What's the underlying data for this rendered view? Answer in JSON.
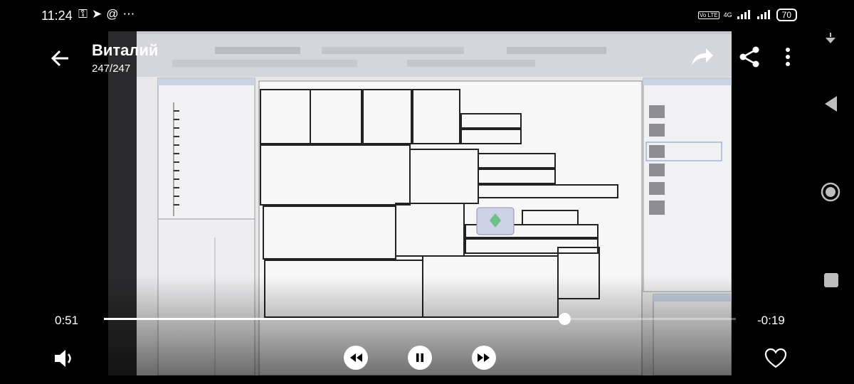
{
  "status_bar": {
    "time": "11:24",
    "left_icons": [
      "key-icon",
      "telegram-icon",
      "at-icon",
      "more-dots-icon"
    ],
    "network": "4G",
    "volte": "Vo LTE",
    "battery": "70"
  },
  "header": {
    "title": "Виталий",
    "subtitle": "247/247"
  },
  "player": {
    "elapsed": "0:51",
    "remaining": "-0:19",
    "progress": 0.729
  },
  "colors": {
    "overlay_text": "#ffffff",
    "background": "#000000",
    "video_bg": "#c9c7cc"
  },
  "nav": {
    "icons": [
      "pull-down-icon",
      "back-triangle-icon",
      "home-circle-icon",
      "recents-square-icon"
    ]
  }
}
